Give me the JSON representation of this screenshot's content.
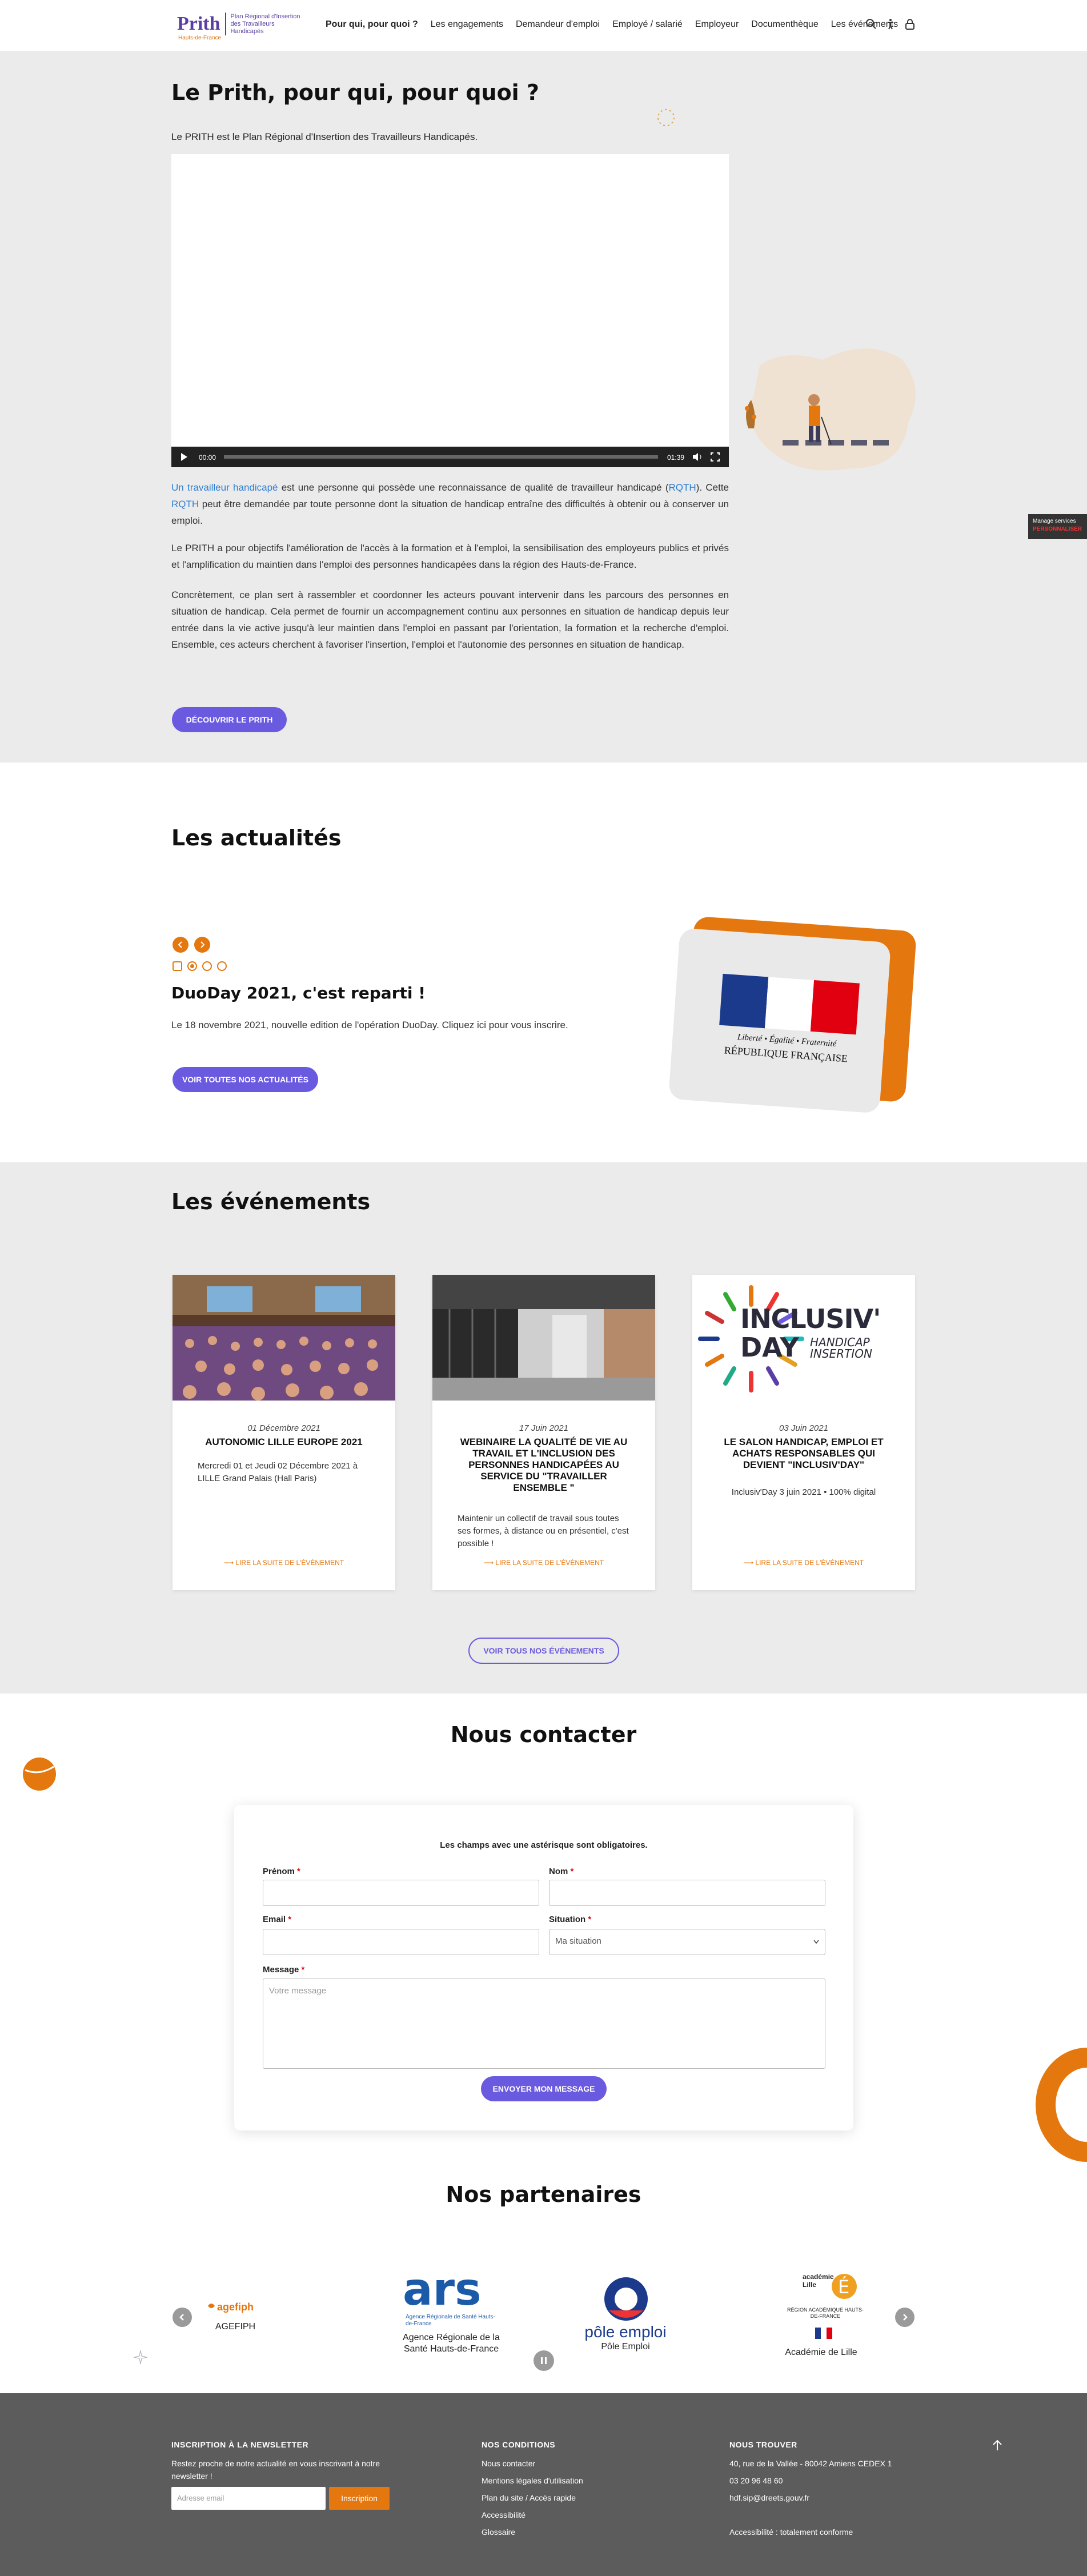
{
  "header": {
    "logo_word": "Prith",
    "logo_sub": "Hauts-de-France",
    "logo_desc": "Plan Régional d'Insertion des Travailleurs Handicapés",
    "nav": [
      "Pour qui, pour quoi ?",
      "Les engagements",
      "Demandeur d'emploi",
      "Employé / salarié",
      "Employeur",
      "Documenthèque",
      "Les événements"
    ],
    "icons": [
      "search-icon",
      "accessibility-icon",
      "lock-icon"
    ]
  },
  "intro": {
    "title": "Le Prith, pour qui, pour quoi ?",
    "lead": "Le PRITH est le Plan Régional d'Insertion des Travailleurs Handicapés.",
    "video_time_current": "00:00",
    "video_time_total": "01:39",
    "p1_link": "Un travailleur handicapé",
    "p1_a": " est une personne qui possède une reconnaissance de qualité de travailleur handicapé (",
    "p1_rqth1": "RQTH",
    "p1_b": "). Cette ",
    "p1_rqth2": "RQTH",
    "p1_c": " peut être demandée par toute personne dont la situation de handicap entraîne des difficultés à obtenir ou à conserver un emploi.",
    "p2": "Le PRITH a pour objectifs l'amélioration de l'accès à la formation et à l'emploi, la sensibilisation des employeurs publics et privés et l'amplification du maintien dans l'emploi des personnes handicapées dans la région des Hauts-de-France.",
    "p3": "Concrètement, ce plan sert à rassembler et coordonner les acteurs pouvant intervenir dans les parcours des personnes en situation de handicap. Cela permet de fournir un accompagnement continu aux personnes en situation de handicap depuis leur entrée dans la vie active jusqu'à leur maintien dans l'emploi en passant par l'orientation, la formation et la recherche d'emploi. Ensemble, ces acteurs cherchent à favoriser l'insertion, l'emploi et l'autonomie des personnes en situation de handicap.",
    "button": "DÉCOUVRIR LE PRITH"
  },
  "cookie_tab": {
    "line1": "Manage services",
    "line2": "PERSONNALISER"
  },
  "news": {
    "title": "Les actualités",
    "item_title": "DuoDay 2021, c'est reparti !",
    "item_text": "Le 18 novembre 2021, nouvelle edition de l'opération DuoDay. Cliquez ici pour vous inscrire.",
    "button": "VOIR TOUTES NOS ACTUALITÉS",
    "rf_line1": "Liberté • Égalité • Fraternité",
    "rf_line2": "RÉPUBLIQUE FRANÇAISE"
  },
  "events": {
    "title": "Les événements",
    "cards": [
      {
        "date": "01 Décembre 2021",
        "title": "AUTONOMIC LILLE EUROPE 2021",
        "text": "Mercredi 01 et Jeudi 02 Décembre 2021 à LILLE Grand Palais (Hall Paris)",
        "link": "LIRE LA SUITE DE L'ÉVÉNEMENT"
      },
      {
        "date": "17 Juin 2021",
        "title": "WEBINAIRE LA QUALITÉ DE VIE AU TRAVAIL ET L'INCLUSION DES PERSONNES HANDICAPÉES AU SERVICE DU \"TRAVAILLER ENSEMBLE \"",
        "text": "Maintenir un collectif de travail sous toutes ses formes, à distance ou en présentiel, c'est possible !",
        "link": "LIRE LA SUITE DE L'ÉVÉNEMENT"
      },
      {
        "date": "03 Juin 2021",
        "title": "LE SALON HANDICAP, EMPLOI ET ACHATS RESPONSABLES QUI DEVIENT \"INCLUSIV'DAY\"",
        "text": "Inclusiv'Day 3 juin 2021 • 100% digital",
        "link": "LIRE LA SUITE DE L'ÉVÉNEMENT"
      }
    ],
    "inclusiv_word": "INCLUSIV'",
    "inclusiv_day": "DAY",
    "inclusiv_sub1": "HANDICAP",
    "inclusiv_sub2": "INSERTION",
    "button": "VOIR TOUS NOS ÉVÉNEMENTS"
  },
  "contact": {
    "title": "Nous contacter",
    "required_note": "Les champs avec une astérisque sont obligatoires.",
    "firstname_label": "Prénom",
    "lastname_label": "Nom",
    "email_label": "Email",
    "situation_label": "Situation",
    "situation_value": "Ma situation",
    "message_label": "Message",
    "message_placeholder": "Votre message",
    "star": "*",
    "button": "ENVOYER MON MESSAGE"
  },
  "partners": {
    "title": "Nos partenaires",
    "items": [
      {
        "logo": "agefiph",
        "name": "AGEFIPH"
      },
      {
        "logo": "ars",
        "name": "Agence Régionale de la Santé Hauts-de-France"
      },
      {
        "logo": "pôle emploi",
        "name": "Pôle Emploi"
      },
      {
        "logo": "académie Lille",
        "name": "Académie de Lille"
      }
    ],
    "ars_sub": "Agence Régionale de Santé Hauts-de-France",
    "academie_sub": "RÉGION ACADÉMIQUE HAUTS-DE-FRANCE"
  },
  "footer": {
    "newsletter_title": "INSCRIPTION À LA NEWSLETTER",
    "newsletter_text": "Restez proche de notre actualité en vous inscrivant à notre newsletter !",
    "newsletter_placeholder": "Adresse email",
    "newsletter_button": "Inscription",
    "conditions_title": "NOS CONDITIONS",
    "conditions": [
      "Nous contacter",
      "Mentions légales d'utilisation",
      "Plan du site / Accès rapide",
      "Accessibilité",
      "Glossaire"
    ],
    "find_title": "NOUS TROUVER",
    "address": "40, rue de la Vallée - 80042 Amiens CEDEX 1",
    "phone": "03 20 96 48 60",
    "email": "hdf.sip@dreets.gouv.fr",
    "accessibility": "Accessibilité : totalement conforme"
  },
  "colors": {
    "accent": "#6a5ae0",
    "orange": "#e5770f",
    "link": "#2f7fd3",
    "grey_bg": "#ebebeb",
    "footer_bg": "#5c5c5c"
  }
}
